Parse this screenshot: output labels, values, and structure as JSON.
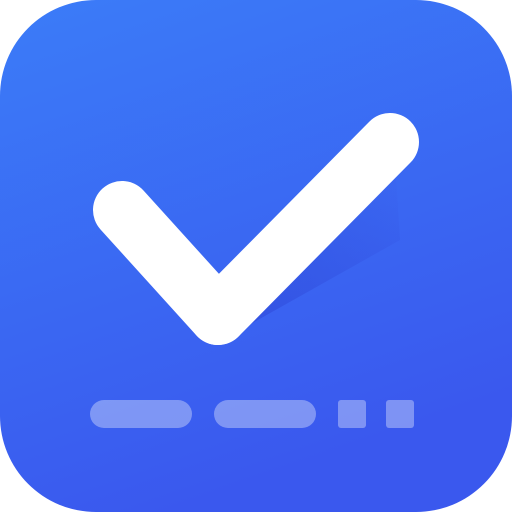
{
  "app_icon": {
    "icon_name": "checkmark-icon",
    "colors": {
      "background_gradient_top": "#3B7CF8",
      "background_gradient_bottom": "#3A58EE",
      "checkmark": "#FFFFFF",
      "checkmark_shadow": "#2C43D4",
      "indicator": "#FFFFFF"
    },
    "indicators": [
      "pill",
      "pill",
      "square",
      "square"
    ]
  }
}
